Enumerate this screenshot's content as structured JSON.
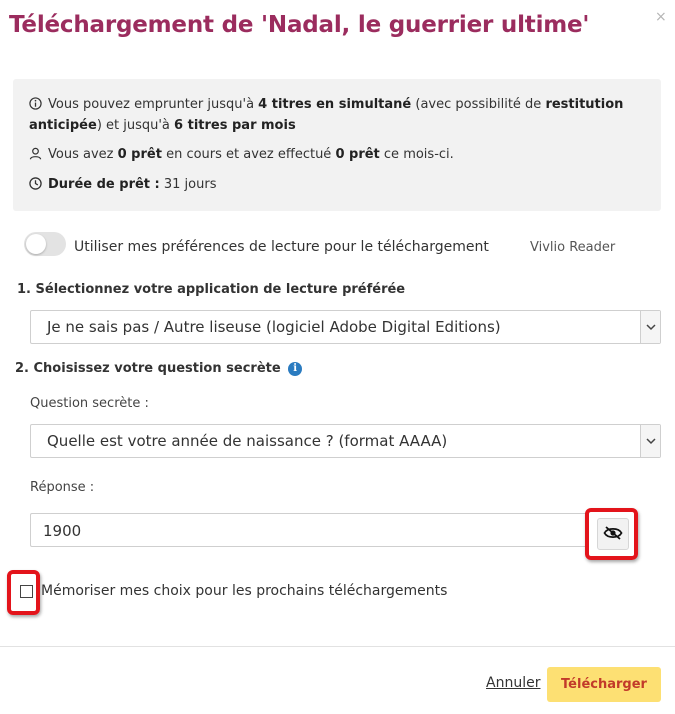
{
  "dialog": {
    "title": "Téléchargement de 'Nadal, le guerrier ultime'",
    "close_glyph": "×"
  },
  "info": {
    "line1": {
      "t1": "Vous pouvez emprunter jusqu'à ",
      "b1": "4 titres en simultané",
      "t2": " (avec possibilité de ",
      "b2": "restitution",
      "b3": "anticipée",
      "t3": ") et jusqu'à ",
      "b4": "6 titres par mois"
    },
    "line2": {
      "t1": "Vous avez ",
      "b1": "0 prêt",
      "t2": " en cours et avez effectué ",
      "b2": "0 prêt",
      "t3": " ce mois-ci."
    },
    "line3": {
      "b1": "Durée de prêt :",
      "t1": " 31 jours"
    }
  },
  "preferences": {
    "toggle_label": "Utiliser mes préférences de lecture pour le téléchargement",
    "toggle_on": false,
    "reader_name": "Vivlio Reader"
  },
  "step1": {
    "label": "1. Sélectionnez votre application de lecture préférée",
    "selected": "Je ne sais pas / Autre liseuse (logiciel Adobe Digital Editions)"
  },
  "step2": {
    "label": "2. Choisissez votre question secrète",
    "help_glyph": "i",
    "question_label": "Question secrète :",
    "question_selected": "Quelle est votre année de naissance ? (format AAAA)",
    "answer_label": "Réponse :",
    "answer_value": "1900"
  },
  "remember": {
    "label": "Mémoriser mes choix pour les prochains téléchargements",
    "checked": false
  },
  "footer": {
    "cancel_label": "Annuler",
    "download_label": "Télécharger"
  },
  "colors": {
    "title": "#9b2c5e",
    "highlight": "#e3141b",
    "download_bg": "#fde073",
    "download_text": "#c23a2a",
    "help_icon": "#2a7bc0"
  },
  "icons": [
    "close-icon",
    "info-circle-icon",
    "user-icon",
    "clock-icon",
    "chevron-down-icon",
    "eye-slash-icon",
    "help-info-icon"
  ]
}
